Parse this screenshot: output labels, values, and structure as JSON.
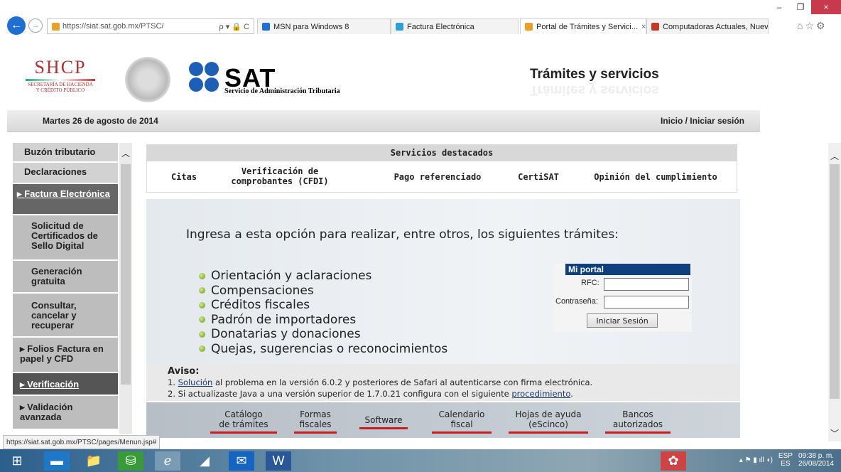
{
  "browser": {
    "url": "https://siat.sat.gob.mx/PTSC/",
    "url_controls": "ρ ▾ 🔒 C",
    "tabs": [
      {
        "label": "MSN para Windows 8",
        "color": "#1e6fd1"
      },
      {
        "label": "Factura Electrónica",
        "color": "#2e9fd8"
      },
      {
        "label": "Portal de Trámites y Servici...",
        "color": "#e8a12a",
        "active": true
      },
      {
        "label": "Computadoras Actuales, Nuev...",
        "color": "#c23a2b"
      }
    ],
    "tab_close": "×",
    "window_controls": {
      "minimize": "–",
      "restore": "❐",
      "close": "×"
    },
    "toolbar_icons": "⌂☆⚙"
  },
  "header": {
    "shcp": "SHCP",
    "shcp_sub1": "SECRETARÍA DE HACIENDA",
    "shcp_sub2": "Y CRÉDITO PÚBLICO",
    "sat_word": "SAT",
    "sat_sub": "Servicio de Administración Tributaria",
    "tramites": "Trámites y servicios",
    "date": "Martes 26 de agosto de 2014",
    "login_link": "Inicio / Iniciar sesión"
  },
  "menu": {
    "items": [
      {
        "label": "Buzón tributario"
      },
      {
        "label": "Declaraciones"
      },
      {
        "label": "Factura Electrónica"
      },
      {
        "label": "Solicitud de Certificados de Sello Digital"
      },
      {
        "label": "Generación gratuita"
      },
      {
        "label": "Consultar, cancelar y recuperar"
      },
      {
        "label": "Folios Factura en papel y CFD"
      },
      {
        "label": "Verificación"
      },
      {
        "label": "Validación avanzada"
      }
    ]
  },
  "servicios": {
    "title": "Servicios destacados",
    "items": [
      "Citas",
      "Verificación de comprobantes (CFDI)",
      "Pago referenciado",
      "CertiSAT",
      "Opinión del cumplimiento"
    ]
  },
  "banner": {
    "intro": "Ingresa a esta opción para realizar, entre otros, los siguientes trámites:",
    "list": [
      "Orientación y aclaraciones",
      "Compensaciones",
      "Créditos fiscales",
      "Padrón de importadores",
      "Donatarias y donaciones",
      "Quejas, sugerencias o reconocimientos"
    ]
  },
  "portal": {
    "title": "Mi portal",
    "rfc_label": "RFC:",
    "password_label": "Contraseña:",
    "login_button": "Iniciar Sesión"
  },
  "aviso": {
    "title": "Aviso:",
    "line1_num": "1.",
    "line1_link": "Solución",
    "line1_text": " al problema en la versión 6.0.2 y posteriores de Safari al autenticarse con firma electrónica.",
    "line2_num": "2.",
    "line2_text": "Si actualizaste Java a una versión superior de 1.7.0.21 configura con el siguiente ",
    "line2_link": "procedimiento",
    "line2_end": "."
  },
  "bottom_links": [
    {
      "l1": "Catálogo",
      "l2": "de trámites"
    },
    {
      "l1": "Formas",
      "l2": "fiscales"
    },
    {
      "l1": "",
      "l2": "Software"
    },
    {
      "l1": "Calendario",
      "l2": "fiscal"
    },
    {
      "l1": "Hojas de ayuda",
      "l2": "(eScinco)"
    },
    {
      "l1": "Bancos",
      "l2": "autorizados"
    }
  ],
  "status_url": "https://siat.sat.gob.mx/PTSC/pages/Menun.jsp#",
  "taskbar": {
    "lang1": "ESP",
    "lang2": "ES",
    "time": "09:38 p. m.",
    "date": "26/08/2014"
  }
}
